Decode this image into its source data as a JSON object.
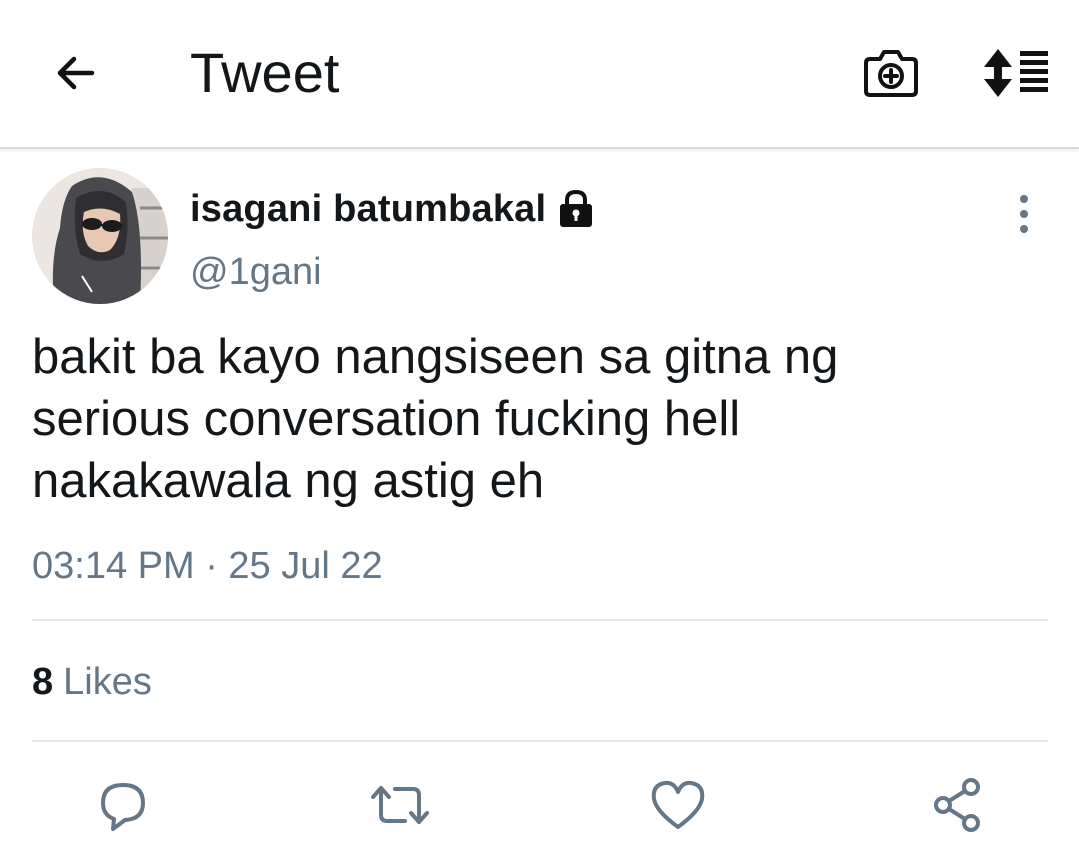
{
  "header": {
    "title": "Tweet",
    "back_icon": "arrow-left-icon",
    "camera_icon": "camera-add-icon",
    "sort_icon": "sort-list-icon"
  },
  "tweet": {
    "author": {
      "display_name": "isagani batumbakal",
      "handle": "@1gani",
      "protected_icon": "lock-icon"
    },
    "text": "bakit ba kayo nangsiseen sa gitna ng\nserious conversation fucking hell\nnakakawala ng astig eh",
    "timestamp": "03:14 PM · 25 Jul 22",
    "likes": {
      "count": "8",
      "label": "Likes"
    }
  },
  "actions": {
    "reply_icon": "reply-bubble-icon",
    "retweet_icon": "retweet-icon",
    "like_icon": "heart-icon",
    "share_icon": "share-icon"
  },
  "colors": {
    "text_primary": "#14171a",
    "text_secondary": "#657786",
    "divider": "#e1e8ed",
    "action_icon": "#657786"
  }
}
